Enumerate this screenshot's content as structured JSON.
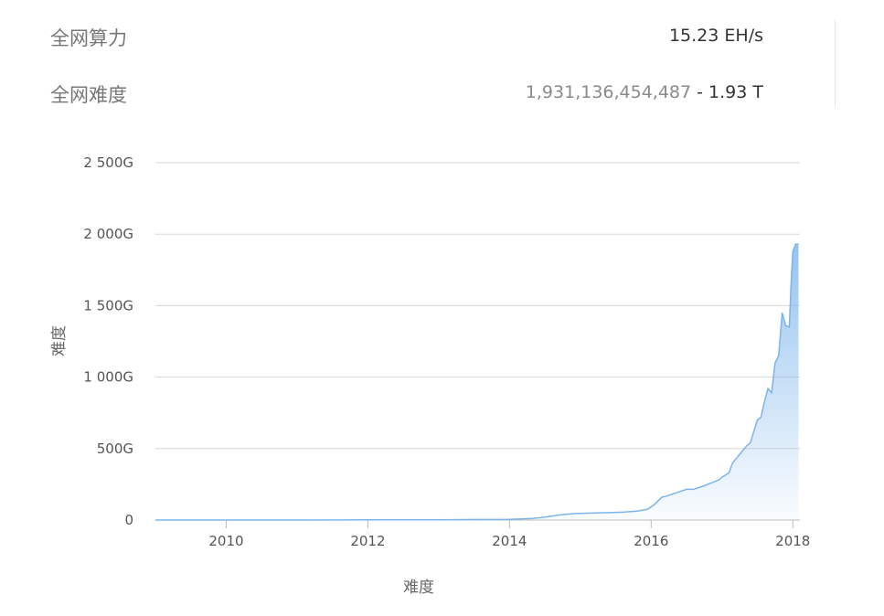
{
  "stats": {
    "hashrate": {
      "label": "全网算力",
      "value": "15.23 EH/s"
    },
    "difficulty": {
      "label": "全网难度",
      "raw": "1,931,136,454,487",
      "separator": " - ",
      "short": "1.93 T"
    }
  },
  "colors": {
    "line": "#7cb5ec",
    "grid": "#d8d8d8"
  },
  "chart_data": {
    "type": "area",
    "xlabel": "难度",
    "ylabel": "难度",
    "ylim": [
      0,
      2500
    ],
    "yunit": "G",
    "yticks": [
      {
        "value": 0,
        "label": "0"
      },
      {
        "value": 500,
        "label": "500G"
      },
      {
        "value": 1000,
        "label": "1 000G"
      },
      {
        "value": 1500,
        "label": "1 500G"
      },
      {
        "value": 2000,
        "label": "2 000G"
      },
      {
        "value": 2500,
        "label": "2 500G"
      }
    ],
    "xlim": [
      2009.0,
      2018.1
    ],
    "xticks": [
      {
        "value": 2010,
        "label": "2010"
      },
      {
        "value": 2012,
        "label": "2012"
      },
      {
        "value": 2014,
        "label": "2014"
      },
      {
        "value": 2016,
        "label": "2016"
      },
      {
        "value": 2018,
        "label": "2018"
      }
    ],
    "x": [
      2009.0,
      2010.0,
      2011.0,
      2012.0,
      2013.0,
      2013.5,
      2014.0,
      2014.3,
      2014.5,
      2014.7,
      2014.9,
      2015.0,
      2015.2,
      2015.4,
      2015.6,
      2015.8,
      2015.95,
      2016.05,
      2016.15,
      2016.2,
      2016.35,
      2016.5,
      2016.6,
      2016.75,
      2016.85,
      2016.95,
      2017.0,
      2017.1,
      2017.15,
      2017.2,
      2017.25,
      2017.35,
      2017.4,
      2017.5,
      2017.55,
      2017.6,
      2017.65,
      2017.7,
      2017.75,
      2017.8,
      2017.85,
      2017.9,
      2017.95,
      2017.98,
      2018.0,
      2018.04,
      2018.08
    ],
    "series": [
      {
        "values": [
          0,
          0,
          0,
          1,
          2,
          4,
          5,
          10,
          20,
          35,
          45,
          46,
          50,
          52,
          55,
          62,
          75,
          110,
          160,
          165,
          190,
          215,
          215,
          240,
          260,
          280,
          300,
          330,
          400,
          430,
          460,
          520,
          540,
          700,
          720,
          830,
          920,
          890,
          1100,
          1150,
          1450,
          1360,
          1350,
          1700,
          1880,
          1930,
          1930
        ]
      }
    ]
  }
}
